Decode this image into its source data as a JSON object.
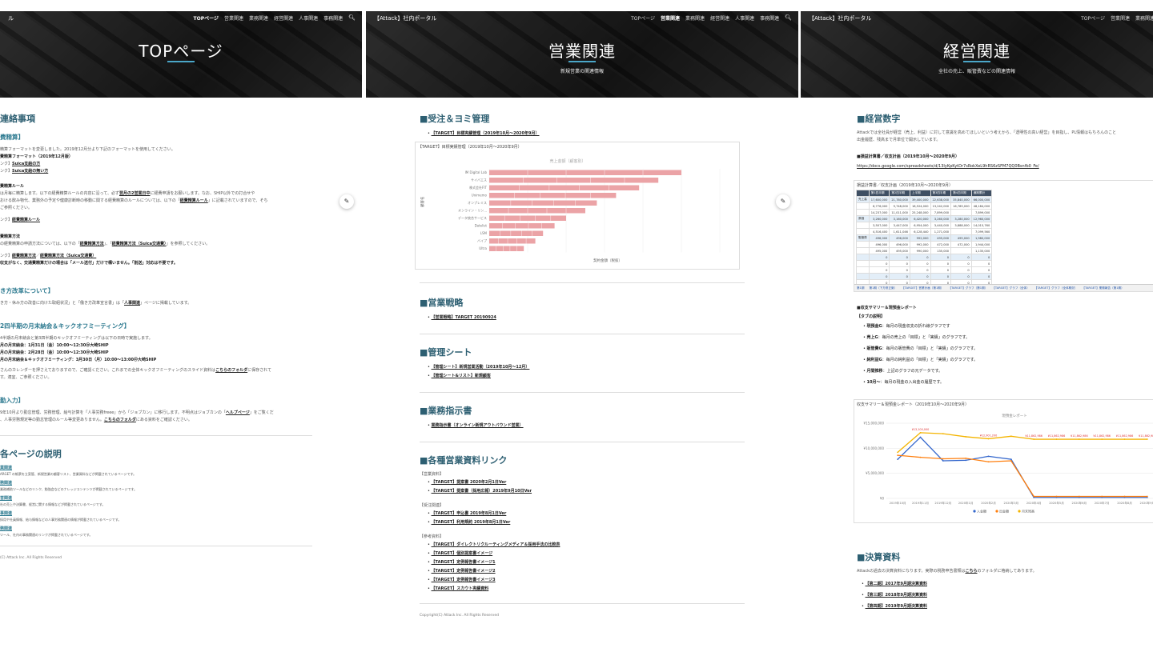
{
  "panel1": {
    "nav": [
      "TOPページ",
      "営業関連",
      "業務関連",
      "経営関連",
      "人事関連",
      "事務関連"
    ],
    "hero_title": "TOPページ",
    "h_main": "連絡事項",
    "s1_title": "費精算】",
    "s1_p1": "精算フォーマットを変更しました。2019年12月分より下記のフォーマットを使用してください。",
    "s1_b1": "費精算フォーマット（2019年12月版）",
    "s1_link1_prefix": "ンク】",
    "s1_link1": "Suica支給の方",
    "s1_link2_prefix": "ンク】",
    "s1_link2": "Suica支給の無い方",
    "s1_b2": "費精算ルール",
    "s1_p2a": "は月毎に精算します。以下の経費精算ルールの内容に沿って、必ず",
    "s1_p2b": "翌月の2営業日中",
    "s1_p2c": "に経費申請をお願いします。なお、SHIP以外での打合せや",
    "s1_p3a": "おける飲み物代、業務外の予定や健康診断時の移動に関する経費精算のルールについては、以下の「",
    "s1_p3b": "経費精算ルール",
    "s1_p3c": "」に記載されていますので、そち",
    "s1_p4": "ご参照ください。",
    "s1_link3_prefix": "ンク】",
    "s1_link3": "経費精算ルール",
    "s1_b3": "費精算方法",
    "s1_p5a": "の経費精算の申請方法については、以下の「",
    "s1_p5b": "経費精算方法",
    "s1_p5c": "」、「",
    "s1_p5d": "経費精算方法（Suica交通費）",
    "s1_p5e": "」を参照してください。",
    "s1_link4_prefix": "ンク】",
    "s1_link4": "経費精算方法",
    "s1_link4_sep": "／",
    "s1_link5": "経費精算方法（Suica交通費）",
    "s1_p6": "収支がなく、交通費精算だけの場合は「メール送付」だけで構いません。「割送」対応は不要です。",
    "s2_title": "き方改革について】",
    "s2_p1a": "き方・休み方の改善に向けた取組状況」と「働き方改革宣言書」は「",
    "s2_p1b": "人事関連",
    "s2_p1c": "」ページに掲載しています。",
    "s3_title": "2四半期の月末納会＆キックオフミーティング】",
    "s3_p1": "4半期の月末納会と第3四半期のキックオフミーティングは以下の日時で実施します。",
    "s3_b1": "月の月末納会：1月31日（金）10:00～12:30＠大崎SHIP",
    "s3_b2": "月の月末納会：2月28日（金）10:00～12:30＠大崎SHIP",
    "s3_b3": "月の月末納会＆キックオフミーティング：3月30日（月）10:00～13:00＠大崎SHIP",
    "s3_p2a": "さんのカレンダーを押さえておりますので、ご確認ください。これまでの全体キックオフミーティングのスライド資料は",
    "s3_p2b": "こちらのフォルダ",
    "s3_p2c": "に保存されて",
    "s3_p3": "す。適宜、ご参照ください。",
    "s4_title": "勤入力】",
    "s4_p1a": "9年10月より勤怠管理、労務管理、給与計算を「人事労務freee」から「ジョブカン」に移行します。不明点はジョブカンの「",
    "s4_p1b": "ヘルプページ",
    "s4_p1c": "」をご覧くだ",
    "s4_p2a": "、人事労務規定等の勤怠管理のルール等変更ありません。",
    "s4_p2b": "こちらのフォルダ",
    "s4_p2c": "にある資料をご確認ください。",
    "h_pages": "各ページの説明",
    "pages": [
      {
        "name": "業関連",
        "desc": "ARGET の帳票を立案管、新規営業の顧客リスト、営業資料などが掲載されているページです。"
      },
      {
        "name": "務関連",
        "desc": "業務補助ツールなどのリンク、勉強会などのナレッジコンテンツが掲載されているページです。"
      },
      {
        "name": "営関連",
        "desc": "社の売上や決算書、経営に関する情報などが掲載されているページです。"
      },
      {
        "name": "事関連",
        "desc": "採用や社員情報、給与情報などの人事労務関連の情報が掲載されているページです。"
      },
      {
        "name": "務関連",
        "desc": "ツール、社内の事務関連のリンクが掲載されているページです。"
      }
    ],
    "footer": "(C) Attack Inc. All Rights Reserved"
  },
  "panel2": {
    "brand": "【Attack】社内ポータル",
    "nav": [
      "TOPページ",
      "営業関連",
      "業務関連",
      "経営関連",
      "人事関連",
      "事務関連"
    ],
    "hero_title": "営業関連",
    "hero_sub": "新規営業の関連情報",
    "sec1_title": "■受注＆ヨミ管理",
    "sec1_link": "【TARGET】目標実績管理（2019年10月～2020年9月）",
    "chart_frame_title": "【TARGET】目標実績管理（2019年10月～2020年9月）",
    "chart_title": "売上金額（顧客別）",
    "chart_ylabel": "顧客名",
    "chart_xlabel": "契約金額（税抜）",
    "chart_categories": [
      "IM Digital Lab",
      "サイバエス",
      "株式会社FIT",
      "Unimemo",
      "オンプレミス",
      "オンライン・リン...",
      "データ統合サービス",
      "Datelist",
      "LSM",
      "バイプ",
      "Ultra"
    ],
    "sec2_title": "■営業戦略",
    "sec2_link": "【営業戦略】TARGET 20190924",
    "sec3_title": "■管理シート",
    "sec3_link1": "【管理シート】新規営業活動（2019年10月～12月）",
    "sec3_link2": "【管理シート&リスト】新規顧客",
    "sec4_title": "■業務指示書",
    "sec4_link": "業務指示書（オンライン新規アウトバウンド営業）",
    "sec5_title": "■各種営業資料リンク",
    "grp1": "【営業資料】",
    "grp1_links": [
      "【TARGET】提案書 2020年2月1日Ver",
      "【TARGET】提案書（採用広報）2019年9月10日Ver"
    ],
    "grp2": "【受注関連】",
    "grp2_links": [
      "【TARGET】申込書 2019年8月1日Ver",
      "【TARGET】利用規約 2019年8月1日Ver"
    ],
    "grp3": "【参考資料】",
    "grp3_links": [
      "【TARGET】ダイレクトリクルーティングメディア＆採用手法の比較表",
      "【TARGET】個別提案書イメージ",
      "【TARGET】定例報告書イメージ1",
      "【TARGET】定例報告書イメージ2",
      "【TARGET】定例報告書イメージ3",
      "【TARGET】スカウト実績資料"
    ],
    "footer": "Copyright(C) Attack Inc. All Rights Reserved"
  },
  "panel3": {
    "brand": "【Attack】社内ポータル",
    "nav": [
      "TOPページ",
      "営業関連",
      "業務関連"
    ],
    "hero_title": "経営関連",
    "hero_sub": "全社の売上、販管費などの関連情報",
    "sec1_title": "■経営数字",
    "sec1_p1": "Attackでは全社員が経営（売上、利益）に対して意識を高めてほしいという考えから、「透明性の高い経営」を目指し、PL情報はもちろんのこと",
    "sec1_p2": "出金履歴、残高まで月単位で開示しています。",
    "sec1_b1": "■損益計算書／収支計画（2019年10月～2020年9月）",
    "sec1_url": "https://docs.google.com/spreadsheets/d/13IyKpKytDr7sRokXeL9hRS6zSFM7QQ0Bsnfb0_Fe/",
    "sheet_title": "損益計算書／収支計画（2019年10月～2020年9月）",
    "sheet_heads": [
      "第1四半期",
      "第2四半期",
      "上半期",
      "第3四半期",
      "第4四半期",
      "通期累計"
    ],
    "sheet_rows": [
      {
        "label": "売上高",
        "vals": [
          "17,600,000",
          "21,780,000",
          "39,400,000",
          "22,638,000",
          "35,840,000",
          "66,000,000"
        ]
      },
      {
        "label": "",
        "vals": [
          "8,776,000",
          "9,748,000",
          "18,524,000",
          "13,242,000",
          "16,789,000",
          "48,184,000"
        ]
      },
      {
        "label": "",
        "vals": [
          "14,237,000",
          "11,011,000",
          "25,248,000",
          "7,899,000",
          "",
          "7,899,000"
        ]
      },
      {
        "label": "原価",
        "vals": [
          "3,260,000",
          "3,160,000",
          "6,420,000",
          "3,260,000",
          "3,280,000",
          "12,960,000"
        ]
      },
      {
        "label": "",
        "vals": [
          "3,507,000",
          "3,447,000",
          "6,954,000",
          "3,440,000",
          "3,888,000",
          "14,015,760"
        ]
      },
      {
        "label": "",
        "vals": [
          "4,516,400",
          "1,611,046",
          "6,128,440",
          "1,271,000",
          "",
          "7,099,560"
        ]
      },
      {
        "label": "販管費",
        "vals": [
          "496,000",
          "496,000",
          "992,000",
          "495,000",
          "495,000",
          "1,980,000"
        ]
      },
      {
        "label": "",
        "vals": [
          "496,000",
          "496,000",
          "992,000",
          "472,000",
          "472,000",
          "1,944,000"
        ]
      },
      {
        "label": "",
        "vals": [
          "495,000",
          "495,000",
          "990,000",
          "135,000",
          "",
          "1,135,000"
        ]
      },
      {
        "label": "",
        "vals": [
          "0",
          "0",
          "0",
          "0",
          "0",
          "0"
        ]
      },
      {
        "label": "",
        "vals": [
          "0",
          "0",
          "0",
          "0",
          "0",
          "0"
        ]
      },
      {
        "label": "",
        "vals": [
          "0",
          "0",
          "0",
          "0",
          "0",
          "0"
        ]
      },
      {
        "label": "",
        "vals": [
          "0",
          "0",
          "0",
          "0",
          "0",
          "0"
        ]
      },
      {
        "label": "",
        "vals": [
          "0",
          "0",
          "0",
          "0",
          "0",
          "0"
        ]
      }
    ],
    "sheet_tabs": [
      "第1期",
      "第1期（下方修正案）",
      "【TARGET】営業計画（第1期）",
      "【TARGET】グラフ（第1期）",
      "【TARGET】グラフ（全体）",
      "【TARGET】グラフ（全体概況）",
      "【TARGET】業務報告（第1期）"
    ],
    "sec1_b2": "■収支サマリー＆現預金レポート",
    "tab_desc_title": "【タブの説明】",
    "tab_items": [
      {
        "name": "現預金G",
        "desc": "：毎月の現金収支の折れ線グラフです"
      },
      {
        "name": "売上G",
        "desc": "：毎月の売上の「目標」と「実績」のグラフです。"
      },
      {
        "name": "販管費G",
        "desc": "：毎月の販管費の「目標」と「実績」のグラフです。"
      },
      {
        "name": "純利益G",
        "desc": "：毎月の純利益の「目標」と「実績」のグラフです。"
      },
      {
        "name": "月間推移",
        "desc": "：上記のグラフの元データです。"
      },
      {
        "name": "10月～",
        "desc": "：毎月の現金の入出金の履歴です。"
      }
    ],
    "chart_frame_title": "収支サマリー＆現預金レポート（2019年10月～2020年9月）",
    "sec2_title": "■決算資料",
    "sec2_p1a": "Attackの過去の決算資料になります。実際の税務申告書類は",
    "sec2_p1b": "こちら",
    "sec2_p1c": "のフォルダに格納してあります。",
    "sec2_links": [
      "【第二期】2017年9月期決算資料",
      "【第三期】2018年9月期決算資料",
      "【第四期】2019年9月期決算資料"
    ]
  },
  "chart_data": [
    {
      "type": "bar",
      "title": "売上金額（顧客別）",
      "xlabel": "契約金額（税抜）",
      "ylabel": "顧客名",
      "categories": [
        "IM Digital Lab",
        "サイバエス",
        "株式会社FIT",
        "Unimemo",
        "オンプレミス",
        "オンライン・リン...",
        "データ統合サービス",
        "Datelist",
        "LSM",
        "バイプ",
        "Ultra"
      ],
      "series": [
        {
          "values": [
            250,
            220,
            195,
            165,
            140,
            125,
            100,
            85,
            70,
            60,
            45
          ]
        }
      ],
      "orientation": "horizontal"
    },
    {
      "type": "line",
      "title": "現預金レポート",
      "x": [
        "2019年10月",
        "2019年11月",
        "2019年12月",
        "2020年1月",
        "2020年2月",
        "2020年3月",
        "2020年4月",
        "2020年5月",
        "2020年6月",
        "2020年7月",
        "2020年8月",
        "2020年9月"
      ],
      "ylim": [
        0,
        15000000
      ],
      "yticks": [
        "¥0",
        "¥5,000,000",
        "¥10,000,000",
        "¥15,000,000"
      ],
      "series": [
        {
          "name": "入金額",
          "color": "#3366cc",
          "values": [
            7800000,
            12200000,
            7500000,
            7600000,
            8400000,
            7800000,
            200000,
            200000,
            200000,
            200000,
            200000,
            200000
          ]
        },
        {
          "name": "出金額",
          "color": "#ff7f0e",
          "values": [
            8600000,
            8200000,
            7900000,
            8000000,
            7300000,
            7500000,
            400000,
            400000,
            400000,
            400000,
            400000,
            400000
          ]
        },
        {
          "name": "月末残高",
          "color": "#f4b400",
          "values": [
            9200000,
            13100000,
            12900000,
            12300000,
            11900000,
            12400000,
            11800000,
            11800000,
            11800000,
            11800000,
            11800000,
            11800000
          ]
        }
      ],
      "annotations": [
        "¥13,100,000",
        "¥12,901,200",
        "¥11,862,986"
      ]
    }
  ]
}
